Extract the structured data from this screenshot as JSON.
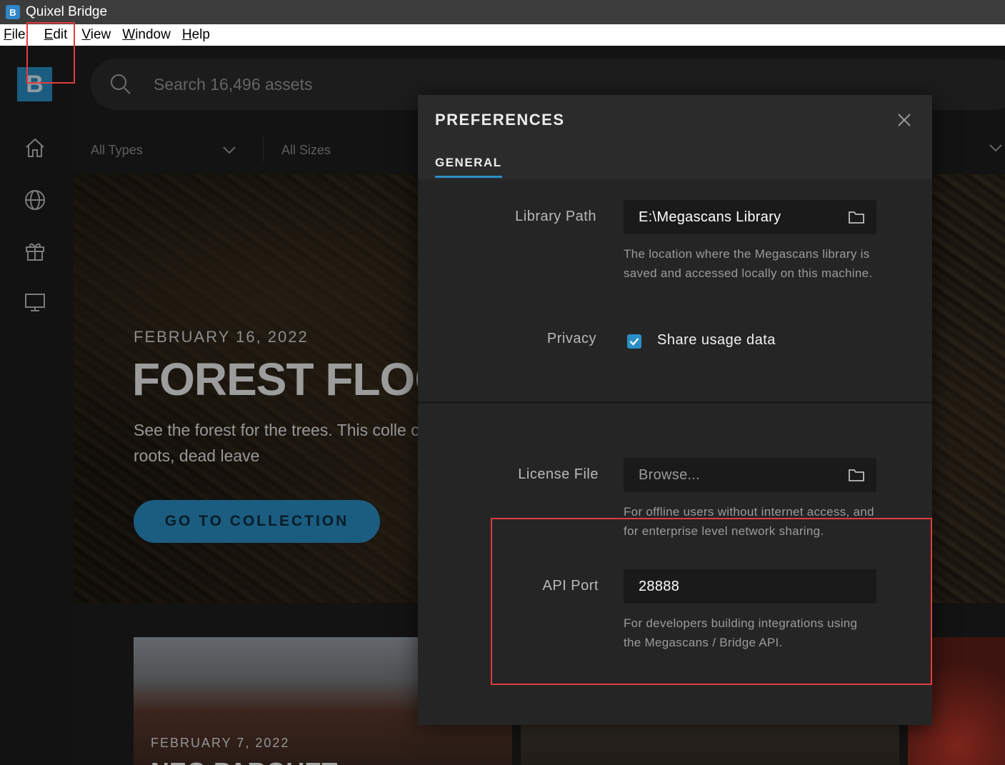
{
  "window": {
    "title": "Quixel Bridge",
    "app_icon_letter": "B"
  },
  "menu": [
    {
      "label": "File"
    },
    {
      "label": "Edit"
    },
    {
      "label": "View"
    },
    {
      "label": "Window"
    },
    {
      "label": "Help"
    }
  ],
  "sidebar": {
    "logo_letter": "B",
    "items": [
      {
        "icon": "home-icon"
      },
      {
        "icon": "globe-icon"
      },
      {
        "icon": "gift-icon"
      },
      {
        "icon": "monitor-icon"
      }
    ]
  },
  "search": {
    "placeholder": "Search 16,496 assets"
  },
  "filters": {
    "types": "All Types",
    "sizes": "All Sizes"
  },
  "hero": {
    "date": "FEBRUARY 16, 2022",
    "title": "FOREST FLOORS",
    "description": "See the forest for the trees. This colle on the forest floor: roots, dead leave",
    "button": "GO TO COLLECTION"
  },
  "cards": [
    {
      "date": "FEBRUARY 7, 2022",
      "title": "NEO PARQUET"
    }
  ],
  "preferences": {
    "title": "PREFERENCES",
    "tab": "GENERAL",
    "library_path": {
      "label": "Library Path",
      "value": "E:\\Megascans Library",
      "help": "The location where the Megascans library is saved and accessed locally on this machine."
    },
    "privacy": {
      "label": "Privacy",
      "checkbox_label": "Share usage data",
      "checked": true
    },
    "license_file": {
      "label": "License File",
      "placeholder": "Browse...",
      "help": "For offline users without internet access, and for enterprise level network sharing."
    },
    "api_port": {
      "label": "API Port",
      "value": "28888",
      "help": "For developers building integrations using the Megascans / Bridge API."
    }
  },
  "colors": {
    "accent": "#2a8fc7",
    "annotation": "#e03c3c"
  }
}
